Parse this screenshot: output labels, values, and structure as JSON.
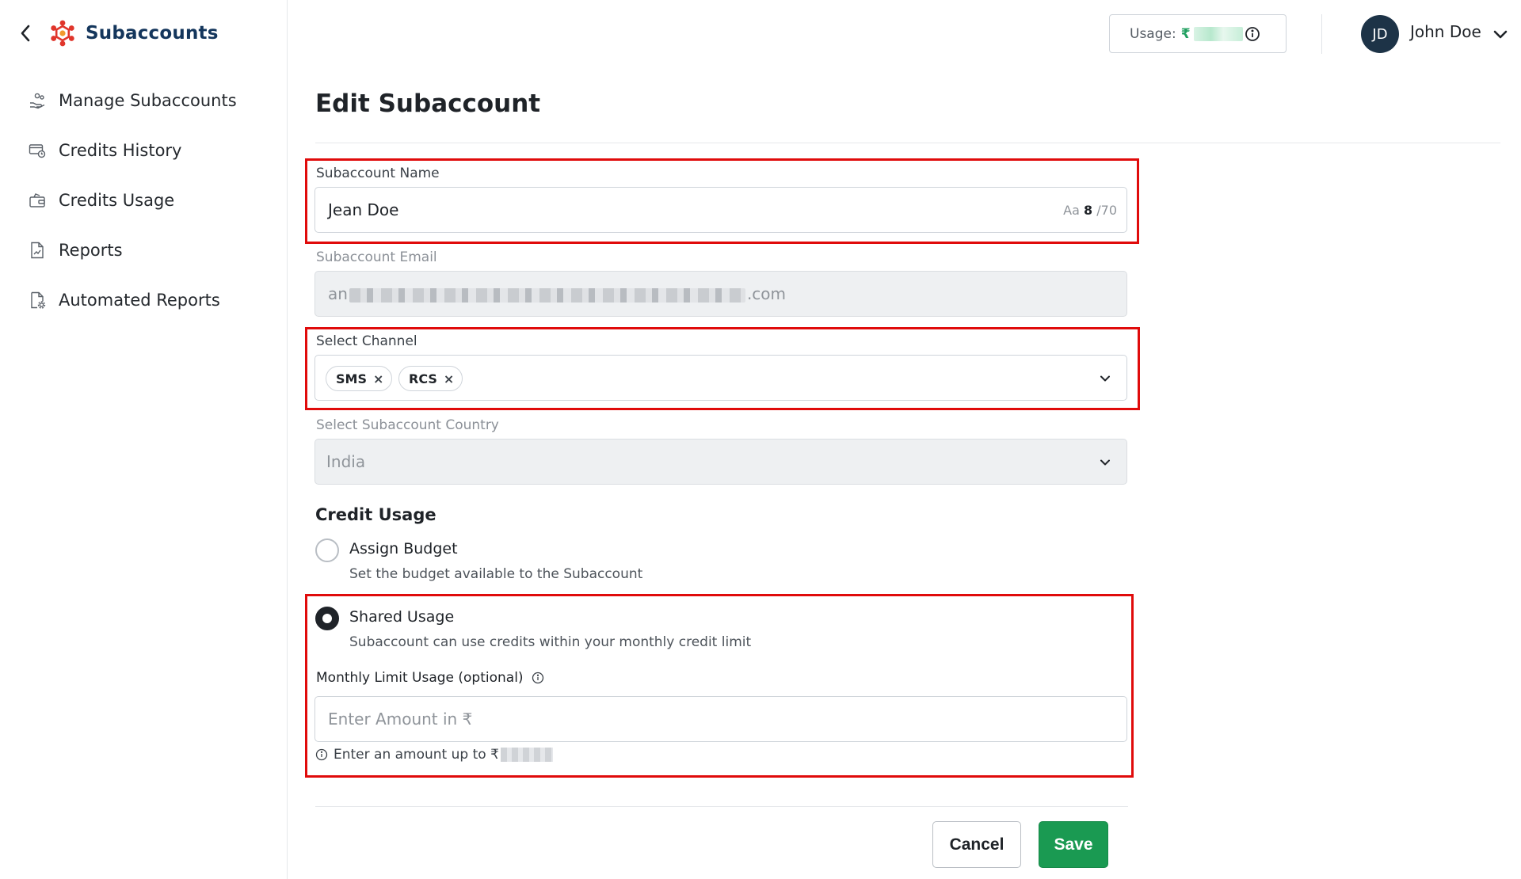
{
  "sidebar": {
    "title": "Subaccounts",
    "items": [
      {
        "label": "Manage Subaccounts",
        "icon": "users-hand-icon"
      },
      {
        "label": "Credits History",
        "icon": "credit-card-clock-icon"
      },
      {
        "label": "Credits Usage",
        "icon": "wallet-icon"
      },
      {
        "label": "Reports",
        "icon": "report-icon"
      },
      {
        "label": "Automated Reports",
        "icon": "report-gear-icon"
      }
    ]
  },
  "topbar": {
    "usage_label": "Usage:",
    "usage_currency": "₹",
    "user_initials": "JD",
    "user_name": "John Doe"
  },
  "page": {
    "title": "Edit Subaccount"
  },
  "form": {
    "name": {
      "label": "Subaccount Name",
      "value": "Jean Doe",
      "counter_prefix": "Aa",
      "count": "8",
      "max": "/70"
    },
    "email": {
      "label": "Subaccount Email",
      "value_start": "an",
      "value_end": ".com"
    },
    "channel": {
      "label": "Select Channel",
      "chips": [
        "SMS",
        "RCS"
      ],
      "chip_remove": "×"
    },
    "country": {
      "label": "Select Subaccount Country",
      "value": "India"
    },
    "credit_usage": {
      "title": "Credit Usage",
      "options": [
        {
          "title": "Assign Budget",
          "desc": "Set the budget available to the Subaccount",
          "selected": false
        },
        {
          "title": "Shared Usage",
          "desc": "Subaccount can use credits within your monthly credit limit",
          "selected": true
        }
      ],
      "limit_label": "Monthly Limit Usage (optional)",
      "limit_placeholder": "Enter Amount in ₹",
      "hint_prefix": "Enter an amount up to ₹"
    }
  },
  "actions": {
    "cancel": "Cancel",
    "save": "Save"
  },
  "colors": {
    "highlight": "#e00b0b",
    "primary": "#1a9a52",
    "brand": "#14365c",
    "logo": "#e0352b"
  }
}
